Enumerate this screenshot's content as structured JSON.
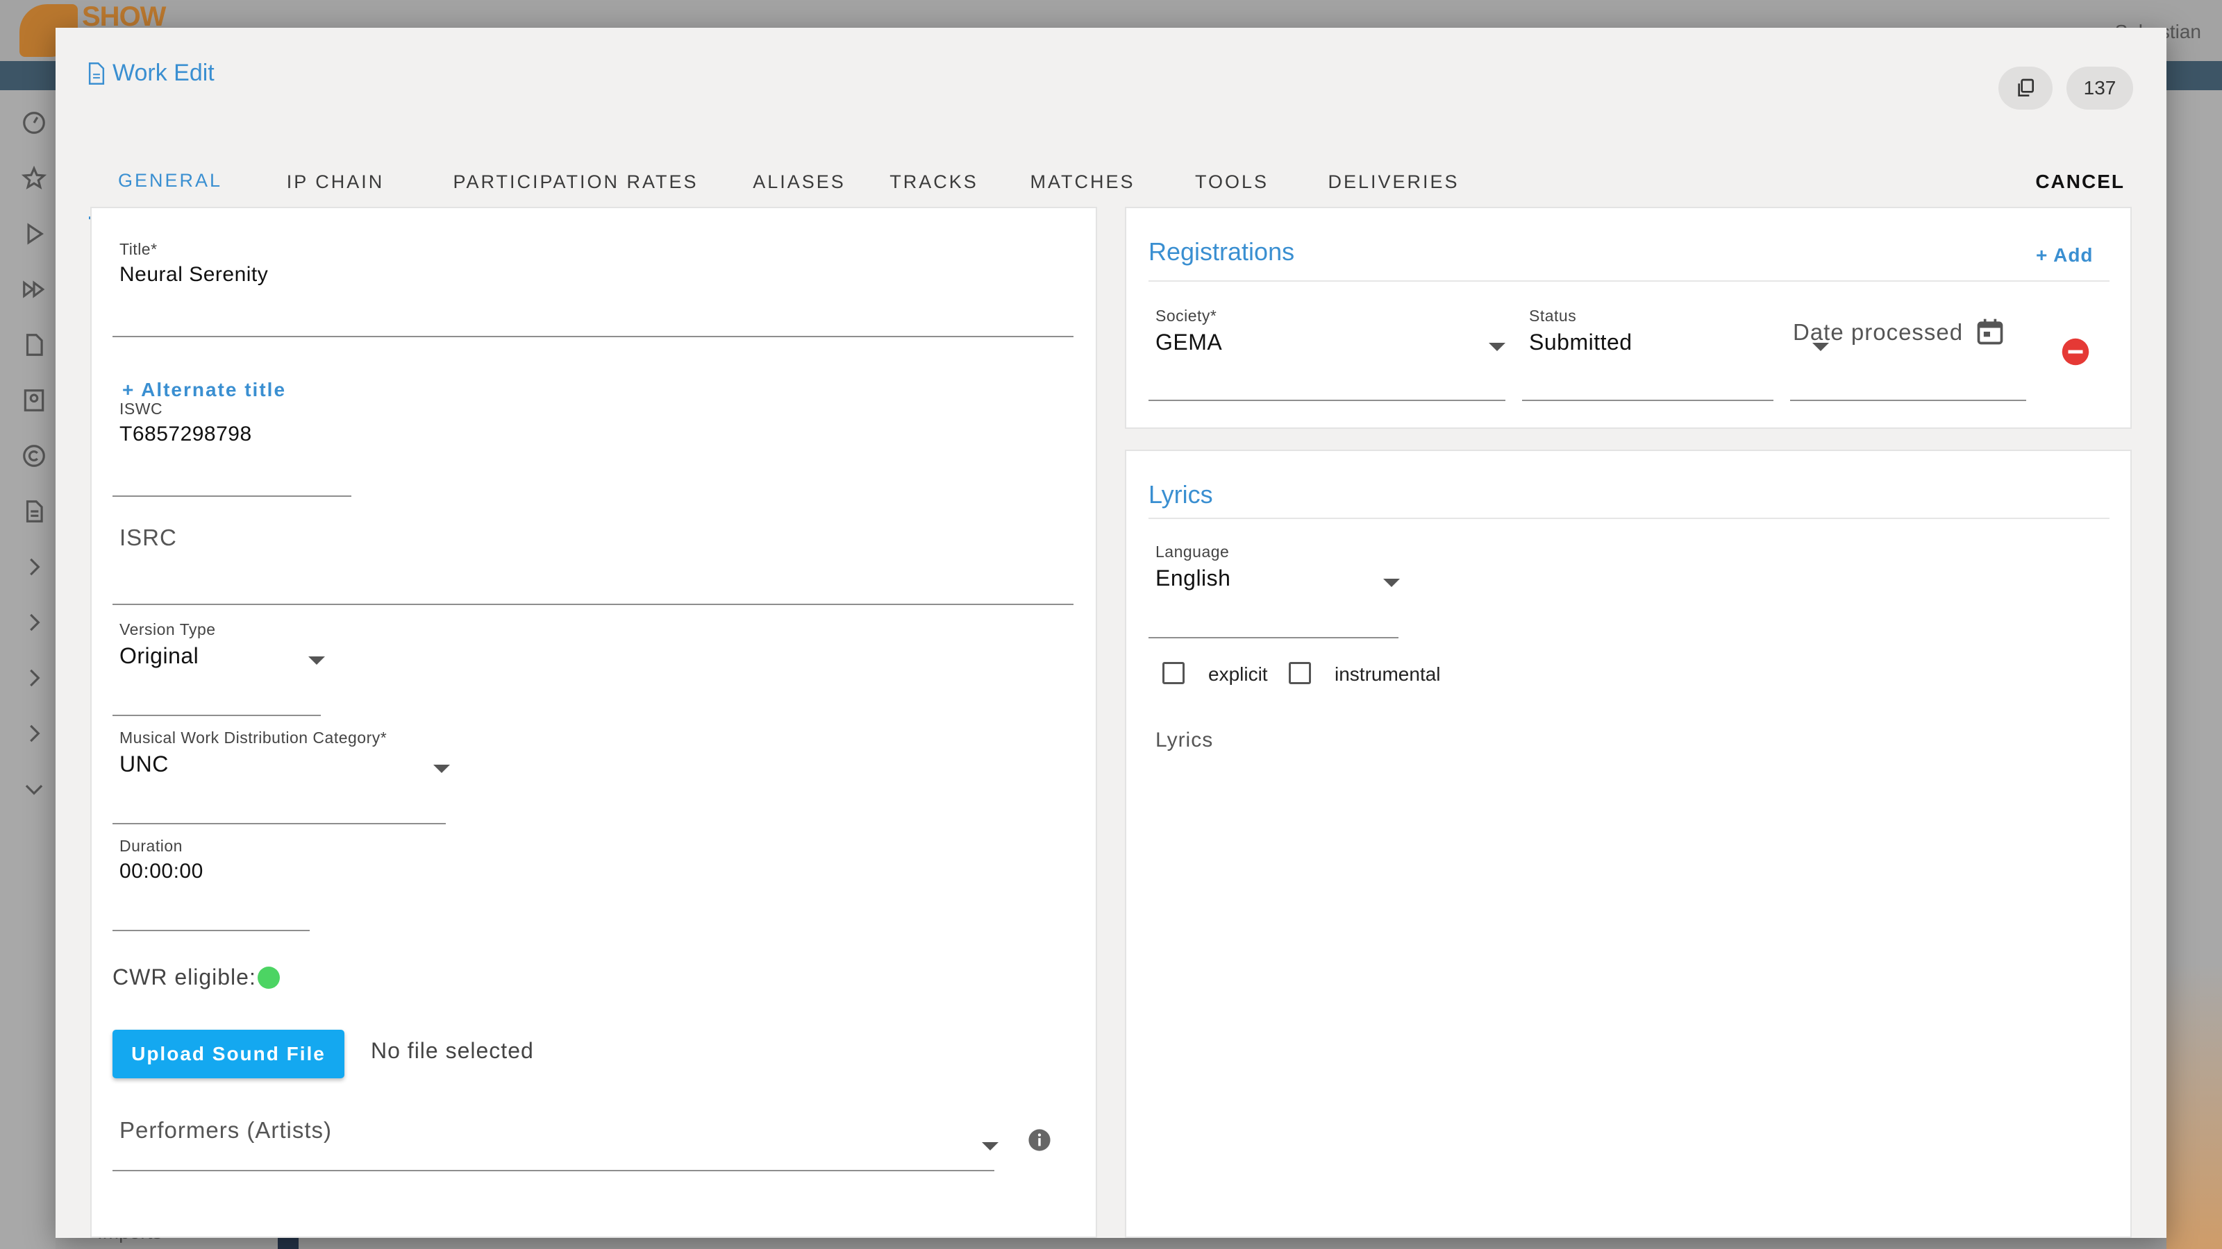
{
  "background": {
    "brand": "SHOW",
    "user": "Sebastian",
    "sidebar_bottom_label": "Imports"
  },
  "dialog": {
    "title": "Work Edit",
    "copy_icon": "copy-icon",
    "id_badge": "137",
    "cancel_label": "CANCEL"
  },
  "tabs": [
    {
      "label": "GENERAL",
      "active": true
    },
    {
      "label": "IP CHAIN",
      "active": false
    },
    {
      "label": "PARTICIPATION RATES",
      "active": false
    },
    {
      "label": "ALIASES",
      "active": false
    },
    {
      "label": "TRACKS",
      "active": false
    },
    {
      "label": "MATCHES",
      "active": false
    },
    {
      "label": "TOOLS",
      "active": false
    },
    {
      "label": "DELIVERIES",
      "active": false
    }
  ],
  "general": {
    "title_label": "Title*",
    "title_value": "Neural Serenity",
    "alternate_title_link": "+ Alternate title",
    "iswc_label": "ISWC",
    "iswc_value": "T6857298798",
    "isrc_placeholder": "ISRC",
    "version_type_label": "Version Type",
    "version_type_value": "Original",
    "distribution_label": "Musical Work Distribution Category*",
    "distribution_value": "UNC",
    "duration_label": "Duration",
    "duration_value": "00:00:00",
    "cwr_label": "CWR eligible:",
    "cwr_status_color": "#4cd463",
    "upload_button": "Upload Sound File",
    "file_status": "No file selected",
    "performers_placeholder": "Performers (Artists)"
  },
  "registrations": {
    "title": "Registrations",
    "add_link": "+ Add",
    "society_label": "Society*",
    "society_value": "GEMA",
    "status_label": "Status",
    "status_value": "Submitted",
    "date_placeholder": "Date processed",
    "remove_color": "#e53935"
  },
  "lyrics": {
    "title": "Lyrics",
    "language_label": "Language",
    "language_value": "English",
    "explicit_label": "explicit",
    "explicit_checked": false,
    "instrumental_label": "instrumental",
    "instrumental_checked": false,
    "lyrics_placeholder": "Lyrics"
  },
  "colors": {
    "accent": "#3a8fd1",
    "upload_button": "#14a8f0"
  }
}
